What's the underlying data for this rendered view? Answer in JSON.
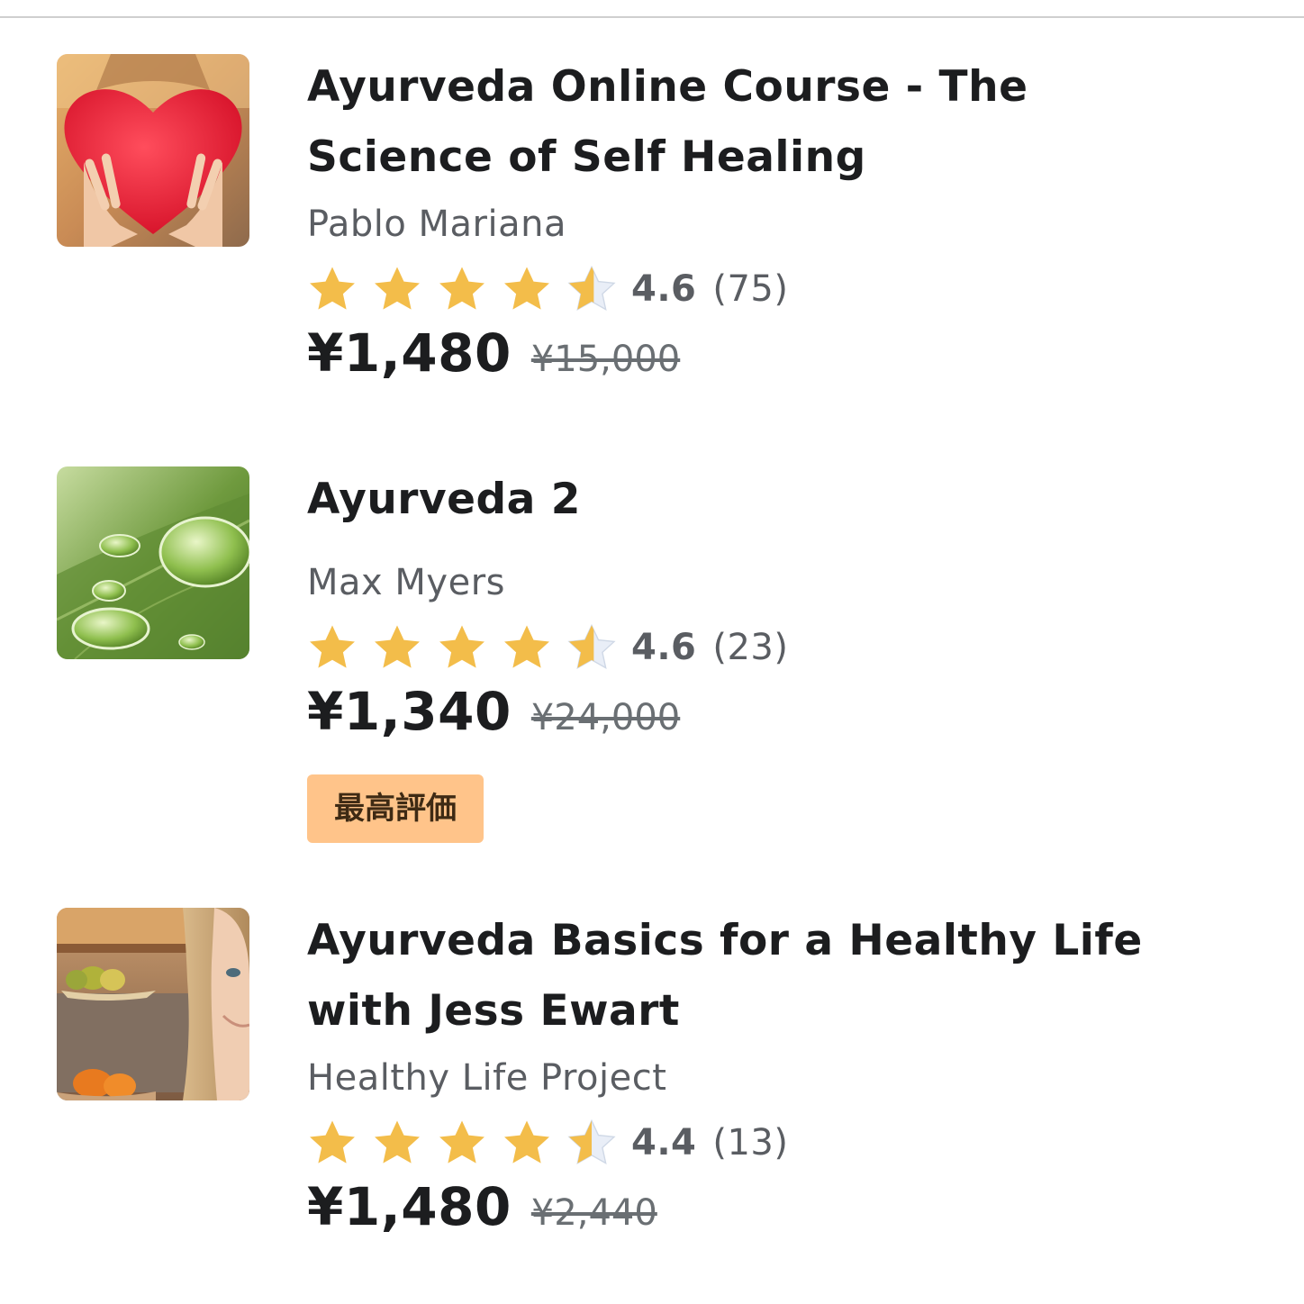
{
  "courses": [
    {
      "thumbnail": "heart-pillow-photo",
      "title_line1": "Ayurveda Online Course - The",
      "title_line2": "Science of Self Healing",
      "instructor": "Pablo Mariana",
      "rating": "4.6",
      "rating_count": "(75)",
      "rating_stars": 4.6,
      "price": "¥1,480",
      "original_price": "¥15,000",
      "badge": ""
    },
    {
      "thumbnail": "leaf-water-drops-photo",
      "title_line1": "Ayurveda 2",
      "title_line2": "",
      "instructor": "Max Myers",
      "rating": "4.6",
      "rating_count": "(23)",
      "rating_stars": 4.6,
      "price": "¥1,340",
      "original_price": "¥24,000",
      "badge": "最高評価"
    },
    {
      "thumbnail": "woman-in-kitchen-photo",
      "title_line1": "Ayurveda Basics for a Healthy Life",
      "title_line2": "with Jess Ewart",
      "instructor": "Healthy Life Project",
      "rating": "4.4",
      "rating_count": "(13)",
      "rating_stars": 4.4,
      "price": "¥1,480",
      "original_price": "¥2,440",
      "badge": ""
    }
  ],
  "colors": {
    "star_fill": "#f3bd4a",
    "star_empty": "#e9eef7",
    "badge_bg": "#ffc48a",
    "title_text": "#1c1d1f",
    "secondary_text": "#5a5d62"
  },
  "icons": {
    "star": "star-icon",
    "half_star": "half-star-icon"
  }
}
